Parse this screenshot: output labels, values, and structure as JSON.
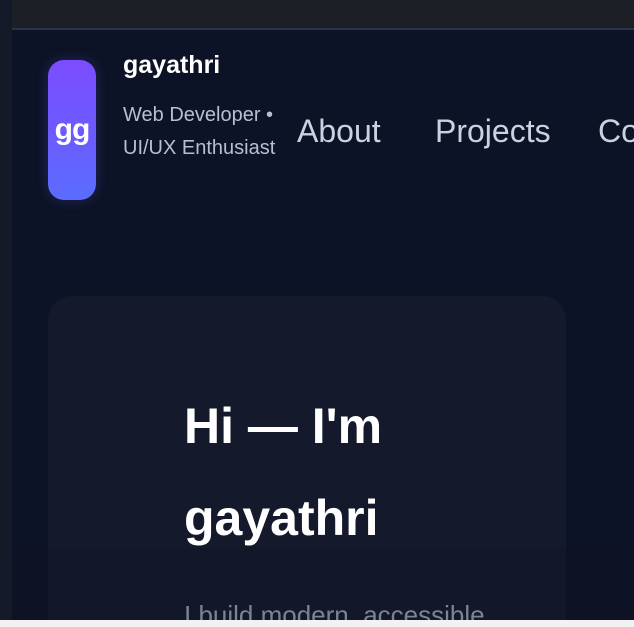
{
  "header": {
    "logo_text": "gg",
    "brand_name": "gayathri",
    "tagline": "Web Developer • UI/UX Enthusiast"
  },
  "nav": {
    "items": [
      "About",
      "Projects",
      "Co"
    ]
  },
  "hero": {
    "title": "Hi — I'm gayathri",
    "subtitle": "I build modern, accessible"
  },
  "colors": {
    "background": "#0d1326",
    "logo_gradient_start": "#7c4dff",
    "logo_gradient_end": "#5b6cff",
    "text_primary": "#ffffff",
    "text_secondary": "#b7bfd0"
  }
}
